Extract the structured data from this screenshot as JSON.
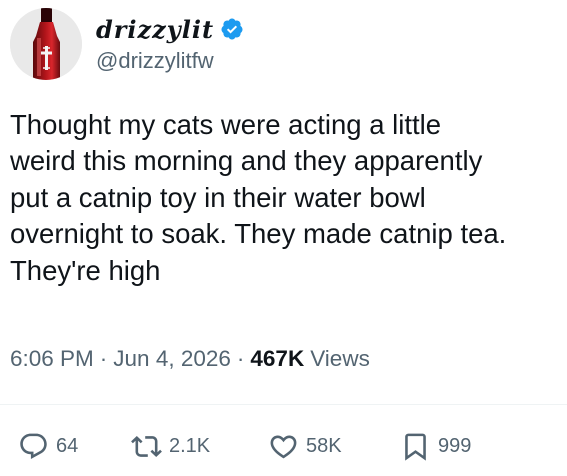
{
  "author": {
    "display_name": "drizzylit",
    "handle": "@drizzylitfw",
    "verified": true,
    "accent_color": "#1d9bf0"
  },
  "tweet": {
    "lines": [
      "Thought my cats were acting a little",
      "weird this morning and they apparently",
      "put a catnip toy in their water bowl",
      "overnight to soak. They made catnip tea.",
      "They're high"
    ],
    "time": "6:06 PM",
    "date": "Jun 4, 2026",
    "separator": "·",
    "views_count": "467K",
    "views_label": "Views"
  },
  "actions": {
    "replies": {
      "icon": "reply-icon",
      "count": "64"
    },
    "retweets": {
      "icon": "retweet-icon",
      "count": "2.1K"
    },
    "likes": {
      "icon": "heart-icon",
      "count": "58K"
    },
    "bookmarks": {
      "icon": "bookmark-icon",
      "count": "999"
    }
  },
  "colors": {
    "text": "#0f1419",
    "muted": "#536471",
    "divider": "#eff3f4"
  }
}
